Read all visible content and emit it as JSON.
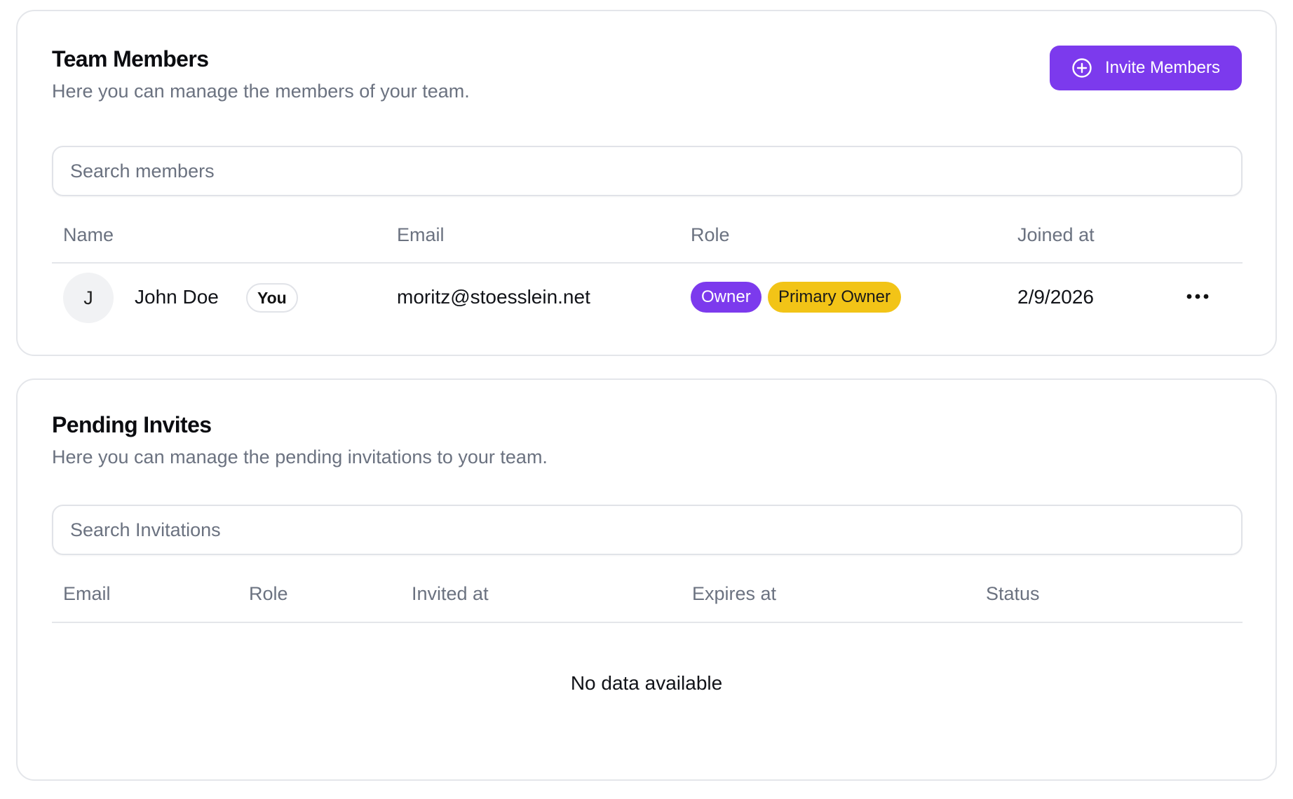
{
  "members_card": {
    "title": "Team Members",
    "description": "Here you can manage the members of your team.",
    "invite_button_label": "Invite Members",
    "search": {
      "placeholder": "Search members",
      "value": ""
    },
    "columns": [
      "Name",
      "Email",
      "Role",
      "Joined at"
    ],
    "rows": [
      {
        "avatar_initial": "J",
        "name": "John Doe",
        "you_badge": "You",
        "email": "moritz@stoesslein.net",
        "roles": [
          "Owner",
          "Primary Owner"
        ],
        "joined_at": "2/9/2026"
      }
    ]
  },
  "invites_card": {
    "title": "Pending Invites",
    "description": "Here you can manage the pending invitations to your team.",
    "search": {
      "placeholder": "Search Invitations",
      "value": ""
    },
    "columns": [
      "Email",
      "Role",
      "Invited at",
      "Expires at",
      "Status"
    ],
    "empty_message": "No data available"
  },
  "icons": {
    "invite": "plus-circle-icon",
    "row_menu": "more-horizontal-icon"
  },
  "colors": {
    "accent": "#7c3aed",
    "primary_owner_badge": "#f2c417",
    "muted_text": "#6b7280",
    "border": "#e4e6ea"
  }
}
